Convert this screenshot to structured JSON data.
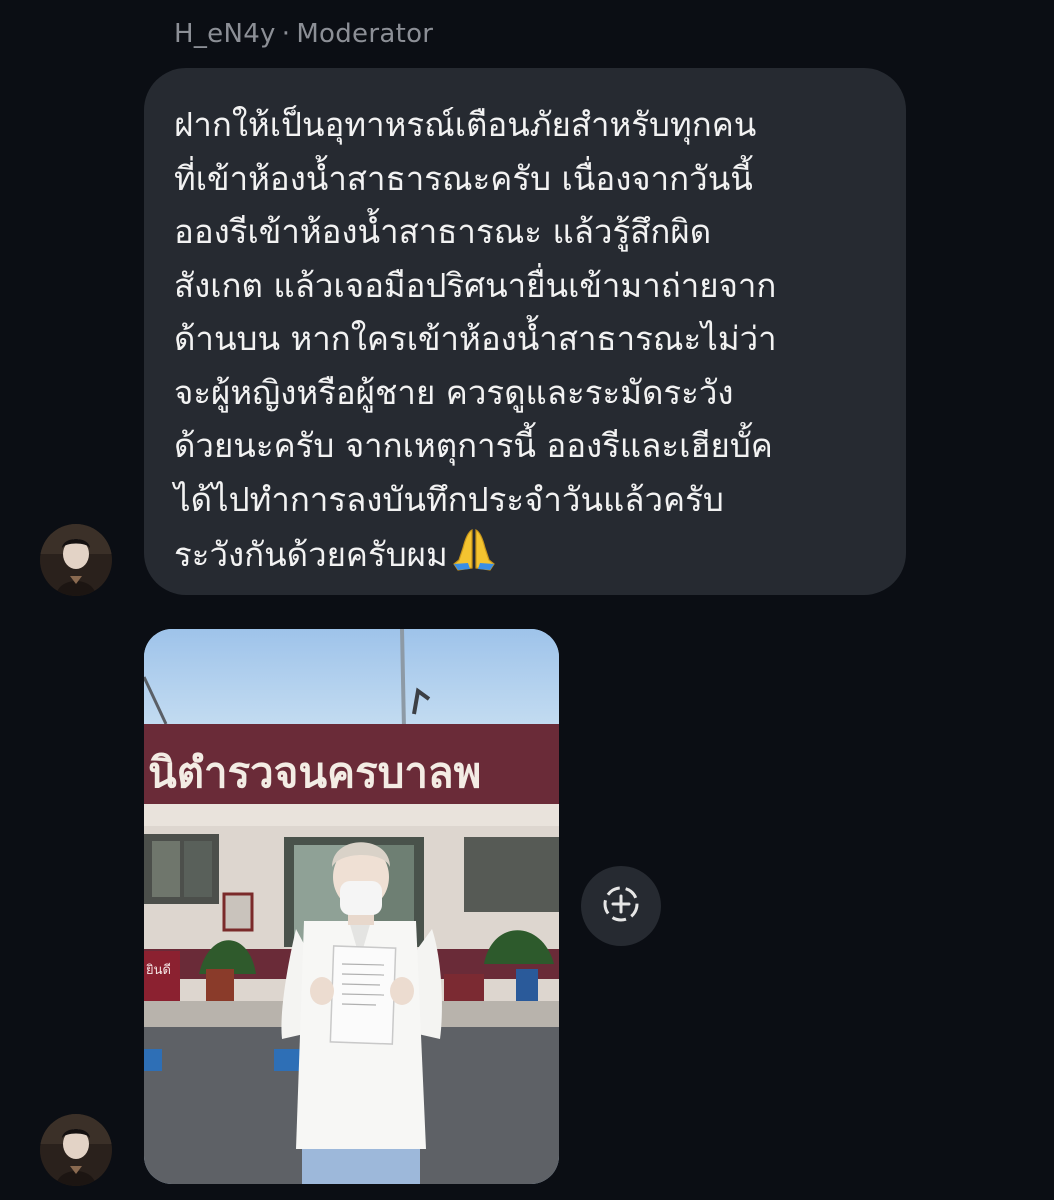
{
  "message": {
    "sender_name": "H_eN4y",
    "separator": "·",
    "sender_role": "Moderator",
    "text_lines": [
      "ฝากให้เป็นอุทาหรณ์เตือนภัยสำหรับทุกคน",
      "ที่เข้าห้องน้ำสาธารณะครับ เนื่องจากวันนี้",
      "อองรีเข้าห้องน้ำสาธารณะ แล้วรู้สึกผิด",
      "สังเกต แล้วเจอมือปริศนายื่นเข้ามาถ่ายจาก",
      "ด้านบน หากใครเข้าห้องน้ำสาธารณะไม่ว่า",
      "จะผู้หญิงหรือผู้ชาย ควรดูและระมัดระวัง",
      "ด้วยนะครับ จากเหตุการนี้ อองรีและเฮียบั้ค",
      "ได้ไปทำการลงบันทึกประจำวันแล้วครับ",
      "ระวังกันด้วยครับผม"
    ],
    "emoji": "🙏"
  },
  "photo": {
    "sign_text": "นิตำรวจนครบาลพ",
    "small_sign_text": "ยินดี"
  },
  "icons": {
    "reaction": "add-reaction-icon",
    "emoji": "praying-hands-icon"
  },
  "colors": {
    "background": "#0b0e14",
    "bubble": "#262a31",
    "text": "#f2f2f2",
    "meta_text": "#8c8f96"
  }
}
